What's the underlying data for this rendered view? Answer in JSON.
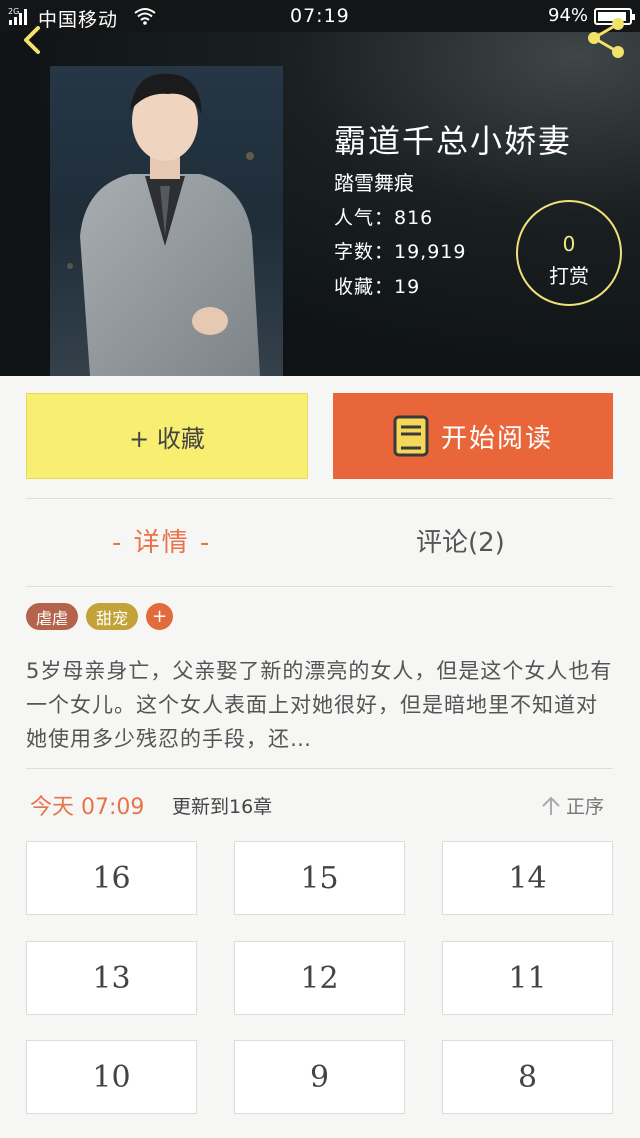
{
  "status_bar": {
    "network": "2G",
    "carrier": "中国移动",
    "time": "07:19",
    "battery": "94%"
  },
  "book": {
    "title": "霸道千总小娇妻",
    "author": "踏雪舞痕",
    "popularity": "人气：816",
    "word_count": "字数：19,919",
    "collections": "收藏：19"
  },
  "reward": {
    "count": "0",
    "label": "打赏"
  },
  "actions": {
    "collect": "+ 收藏",
    "read": "开始阅读"
  },
  "tabs": {
    "detail": "- 详情 -",
    "comments": "评论(2)"
  },
  "tags": [
    "虐虐",
    "甜宠",
    "+"
  ],
  "synopsis": "5岁母亲身亡，父亲娶了新的漂亮的女人，但是这个女人也有一个女儿。这个女人表面上对她很好，但是暗地里不知道对她使用多少残忍的手段，还…",
  "update": {
    "time": "今天 07:09",
    "text": "更新到16章",
    "sort": "正序"
  },
  "chapters": [
    "16",
    "15",
    "14",
    "13",
    "12",
    "11",
    "10",
    "9",
    "8"
  ],
  "colors": {
    "accent": "#e8734a",
    "collect_button": "#f8ef72",
    "read_button": "#e8663a",
    "reward_ring": "#f0e17a"
  },
  "icons": {
    "back": "chevron-left-icon",
    "share": "share-icon",
    "read": "book-icon",
    "sort": "arrow-up-icon"
  }
}
